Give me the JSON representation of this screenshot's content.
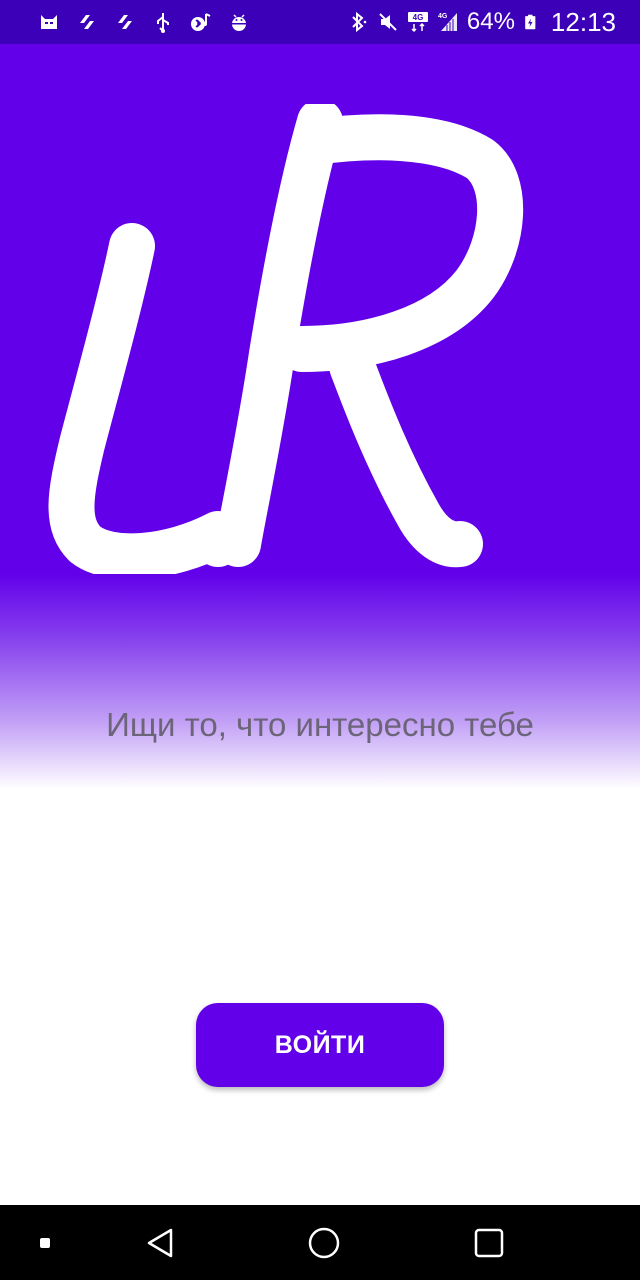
{
  "status_bar": {
    "background": "#3b00b8",
    "left_icons": [
      "cat-app-icon",
      "sync-icon",
      "sync-icon",
      "usb-icon",
      "bluetooth-audio-icon",
      "android-debug-icon"
    ],
    "right_icons": [
      "bluetooth-icon",
      "mute-icon",
      "4g-data-icon",
      "4g-signal-icon",
      "battery-charging-icon"
    ],
    "battery_percent": "64%",
    "time": "12:13"
  },
  "hero": {
    "logo_text": "uR",
    "background": "#6200ea",
    "tagline": "Ищи то, что интересно тебе"
  },
  "login_button": {
    "label": "ВОЙТИ",
    "color": "#6200ea"
  },
  "nav_bar": {
    "buttons": [
      "recents-dot-icon",
      "back-icon",
      "home-icon",
      "overview-icon"
    ]
  }
}
